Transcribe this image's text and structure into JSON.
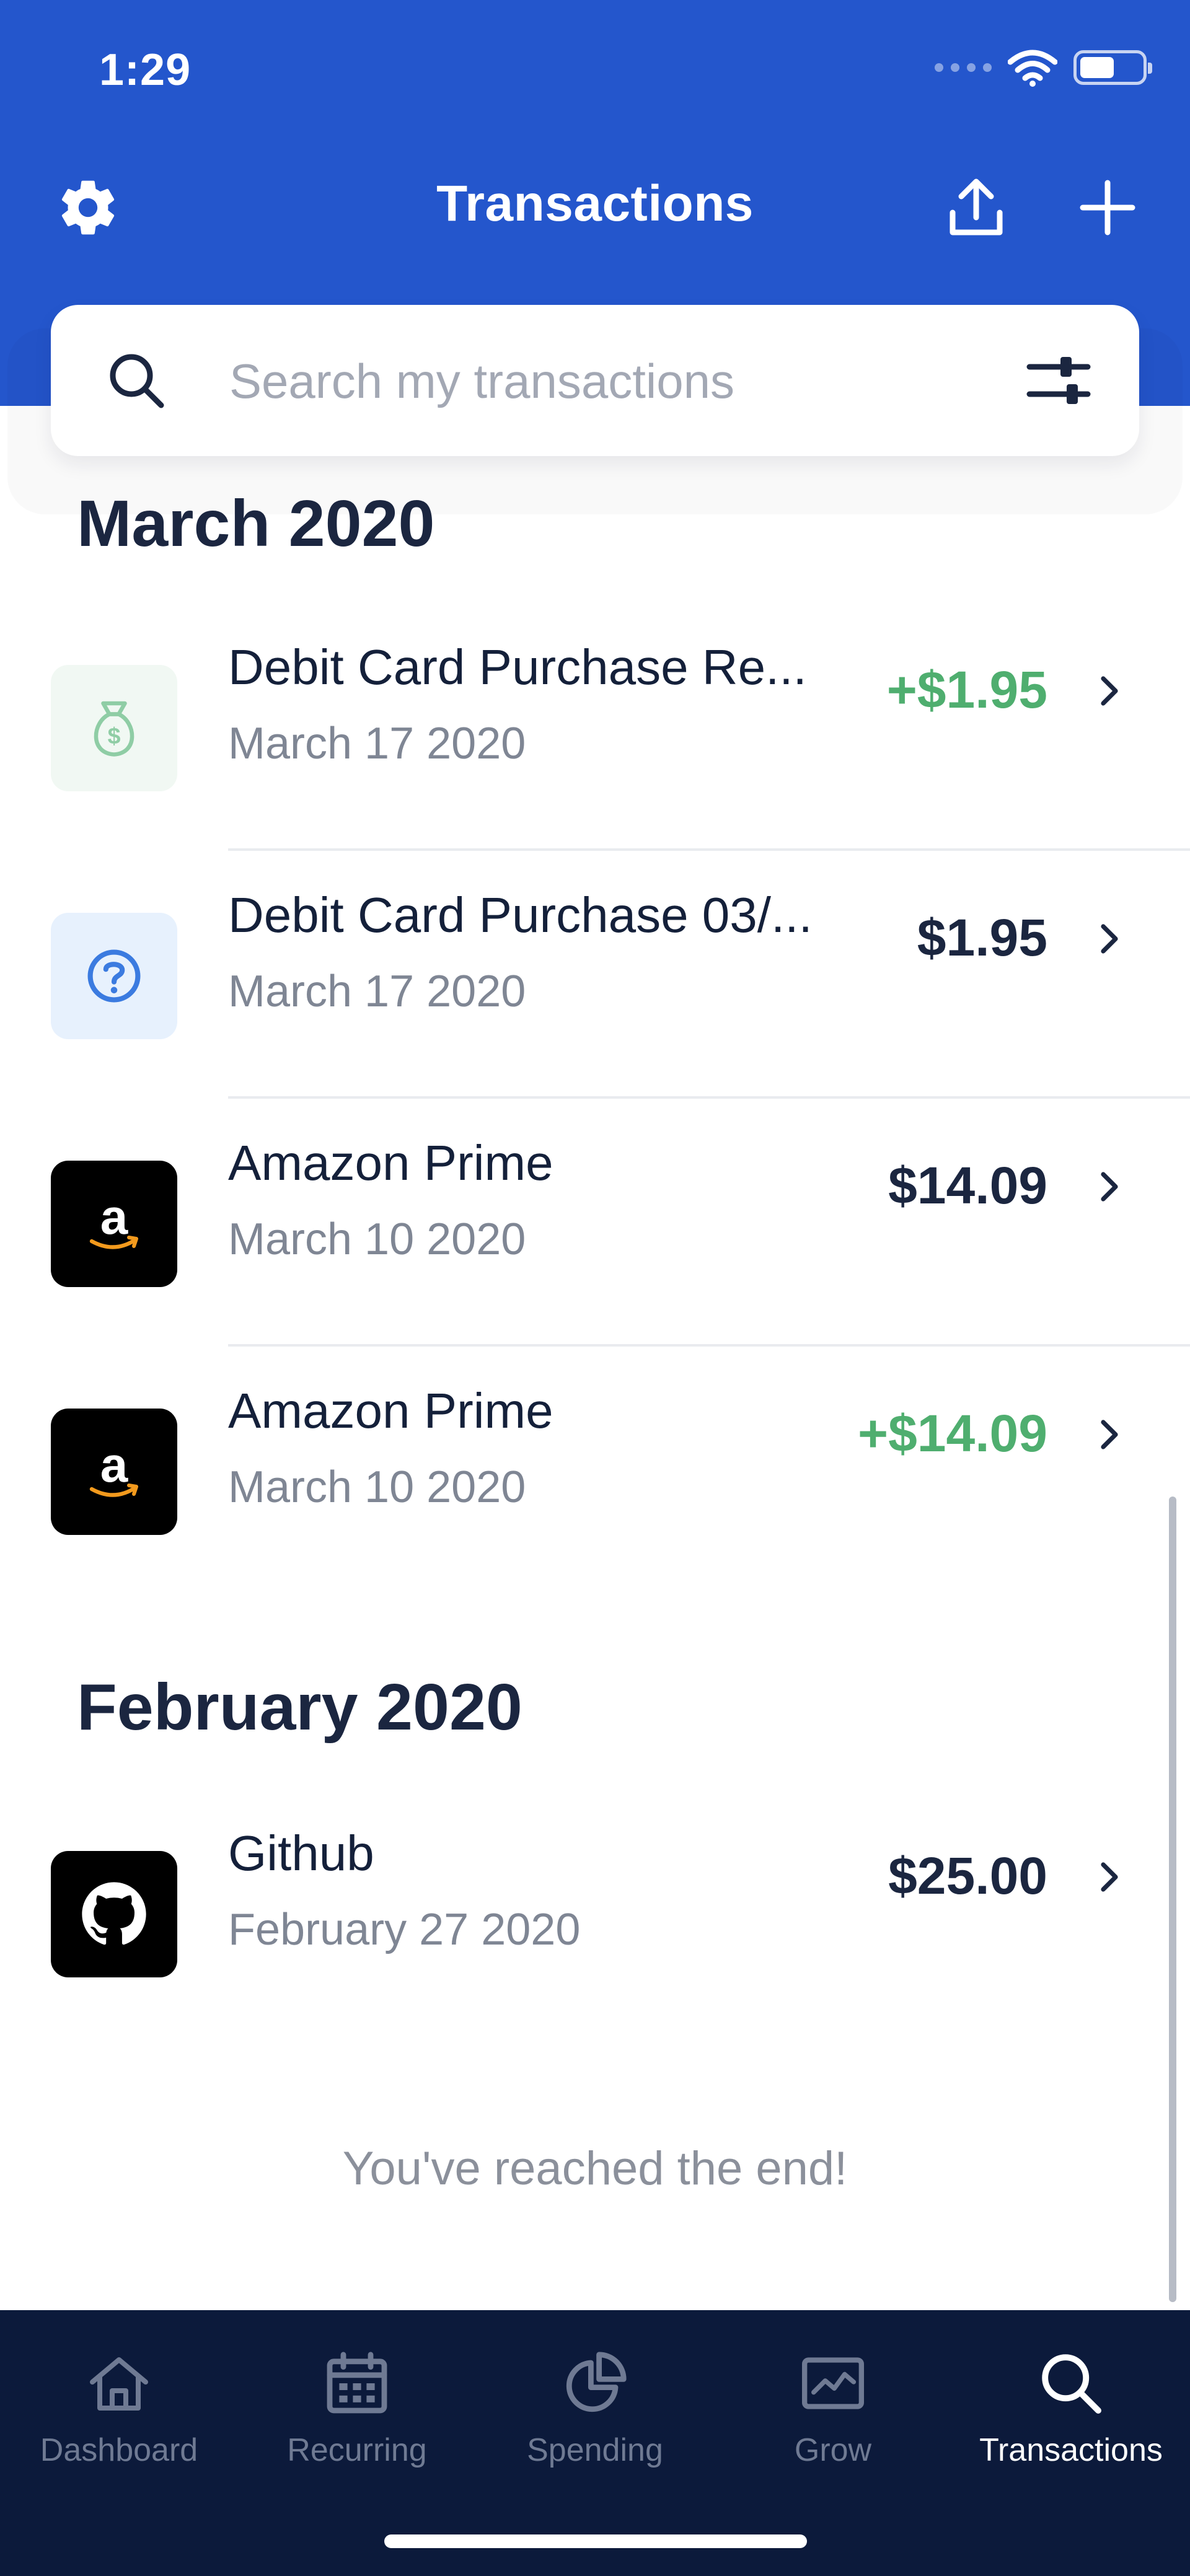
{
  "status_bar": {
    "time": "1:29"
  },
  "header": {
    "title": "Transactions",
    "settings_icon": "gear-icon",
    "export_icon": "upload-icon",
    "add_icon": "plus-icon"
  },
  "search": {
    "placeholder": "Search my transactions",
    "value": "",
    "filter_icon": "sliders-icon"
  },
  "sections": [
    {
      "month": "March 2020",
      "transactions": [
        {
          "name": "Debit Card Purchase Re...",
          "date": "March 17 2020",
          "amount": "+$1.95",
          "positive": true,
          "logo": "money-bag-icon"
        },
        {
          "name": "Debit Card Purchase 03/...",
          "date": "March 17 2020",
          "amount": "$1.95",
          "positive": false,
          "logo": "question-icon"
        },
        {
          "name": "Amazon Prime",
          "date": "March 10 2020",
          "amount": "$14.09",
          "positive": false,
          "logo": "amazon-logo"
        },
        {
          "name": "Amazon Prime",
          "date": "March 10 2020",
          "amount": "+$14.09",
          "positive": true,
          "logo": "amazon-logo"
        }
      ]
    },
    {
      "month": "February 2020",
      "transactions": [
        {
          "name": "Github",
          "date": "February 27 2020",
          "amount": "$25.00",
          "positive": false,
          "logo": "github-logo"
        }
      ]
    }
  ],
  "end_message": "You've reached the end!",
  "tabs": [
    {
      "label": "Dashboard",
      "icon": "home-icon",
      "active": false
    },
    {
      "label": "Recurring",
      "icon": "calendar-icon",
      "active": false
    },
    {
      "label": "Spending",
      "icon": "pie-chart-icon",
      "active": false
    },
    {
      "label": "Grow",
      "icon": "line-chart-icon",
      "active": false
    },
    {
      "label": "Transactions",
      "icon": "search-icon",
      "active": true
    }
  ],
  "colors": {
    "brand_blue": "#2456cc",
    "tab_bar": "#0c1a3b",
    "positive_green": "#4fae6f",
    "text_dark": "#1b2640"
  }
}
